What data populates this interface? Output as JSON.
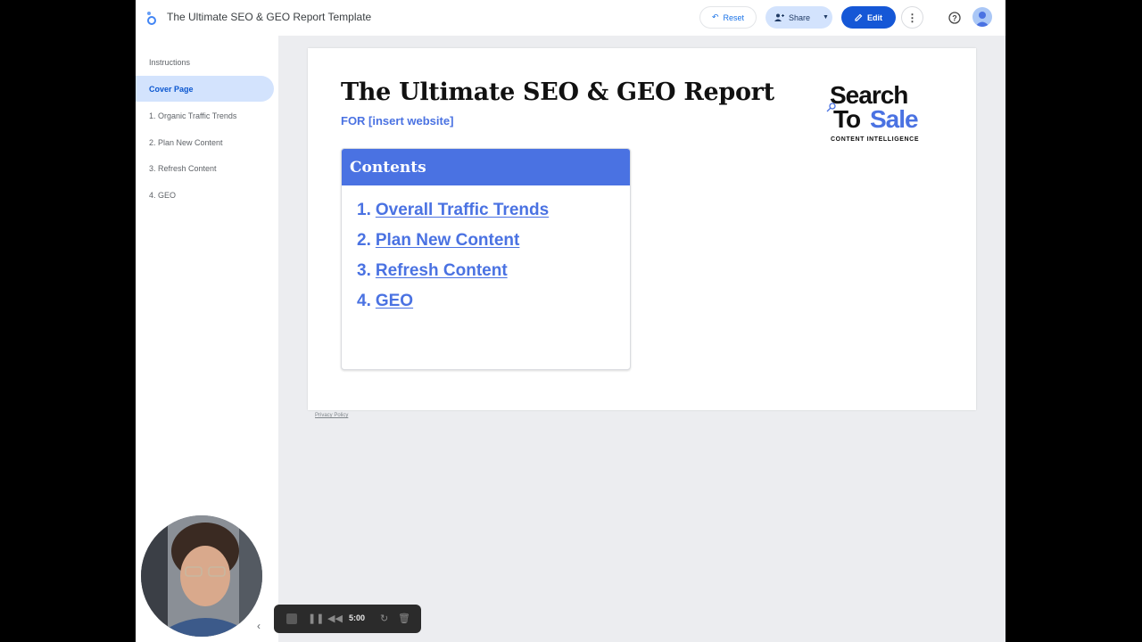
{
  "app": {
    "title": "The Ultimate SEO & GEO Report Template"
  },
  "toolbar": {
    "reset_label": "Reset",
    "share_label": "Share",
    "edit_label": "Edit"
  },
  "sidebar": {
    "items": [
      {
        "label": "Instructions"
      },
      {
        "label": "Cover Page"
      },
      {
        "label": "1. Organic Traffic Trends"
      },
      {
        "label": "2. Plan New Content"
      },
      {
        "label": "3. Refresh Content"
      },
      {
        "label": "4. GEO"
      }
    ],
    "active_index": 1
  },
  "report": {
    "title": "The Ultimate SEO & GEO Report",
    "subtitle": "FOR [insert website]",
    "brand": {
      "line1": "Search",
      "line2_a": "To",
      "line2_b": "Sale",
      "tagline": "CONTENT INTELLIGENCE"
    },
    "contents": {
      "heading": "Contents",
      "items": [
        {
          "num": "1.",
          "label": "Overall Traffic Trends"
        },
        {
          "num": "2.",
          "label": "Plan New Content"
        },
        {
          "num": "3.",
          "label": "Refresh Content"
        },
        {
          "num": "4.",
          "label": "GEO"
        }
      ]
    }
  },
  "footer": {
    "privacy_label": "Privacy Policy"
  },
  "recorder": {
    "time": "5:00"
  },
  "colors": {
    "accent": "#4a72e2",
    "edit_button": "#1557d6",
    "active_nav_bg": "#d3e3fd"
  }
}
